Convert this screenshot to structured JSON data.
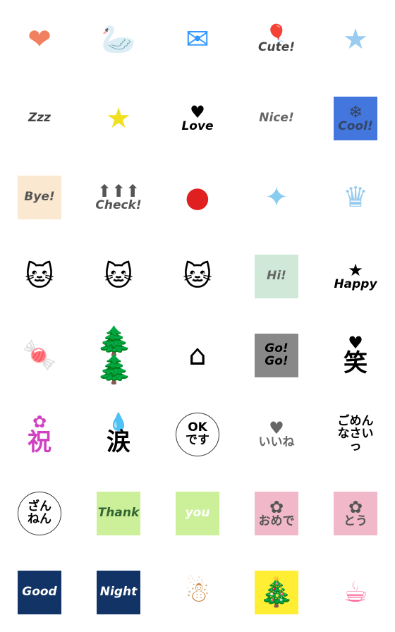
{
  "stickers": [
    {
      "icon": "hearts-icon",
      "text": "",
      "bg": "",
      "fg": "#f08060"
    },
    {
      "icon": "swan-icon",
      "text": "",
      "bg": "",
      "fg": "#b090d0"
    },
    {
      "icon": "envelope-icon",
      "text": "",
      "bg": "",
      "fg": "#3399ff"
    },
    {
      "icon": "balloons-icon",
      "text": "Cute!",
      "bg": "",
      "fg": "#444444"
    },
    {
      "icon": "stars-icon",
      "text": "",
      "bg": "",
      "fg": "#99ccee"
    },
    {
      "icon": "zzz-icon",
      "text": "Zzz",
      "bg": "",
      "fg": "#444444"
    },
    {
      "icon": "magic-wand-icon",
      "text": "",
      "bg": "",
      "fg": "#f0e020"
    },
    {
      "icon": "heart-icon",
      "text": "Love",
      "bg": "",
      "fg": "#000000"
    },
    {
      "icon": "bunting-icon",
      "text": "Nice!",
      "bg": "#ffffff",
      "fg": "#666666"
    },
    {
      "icon": "snowflake-icon",
      "text": "Cool!",
      "bg": "#4477dd",
      "fg": "#334466"
    },
    {
      "icon": "pastel-card-icon",
      "text": "Bye!",
      "bg": "#fbe8d0",
      "fg": "#555555"
    },
    {
      "icon": "arrows-up-icon",
      "text": "Check!",
      "bg": "",
      "fg": "#555555"
    },
    {
      "icon": "apple-icon",
      "text": "",
      "bg": "",
      "fg": "#e02020"
    },
    {
      "icon": "sparkle-icon",
      "text": "",
      "bg": "",
      "fg": "#88ccee"
    },
    {
      "icon": "crown-icon",
      "text": "",
      "bg": "",
      "fg": "#99ccee"
    },
    {
      "icon": "cat-sleepy-icon",
      "text": "",
      "bg": "",
      "fg": "#000000"
    },
    {
      "icon": "cat-face-icon",
      "text": "",
      "bg": "",
      "fg": "#000000"
    },
    {
      "icon": "cat-mask-icon",
      "text": "",
      "bg": "",
      "fg": "#000000"
    },
    {
      "icon": "checkered-card-icon",
      "text": "Hi!",
      "bg": "#cfe8d8",
      "fg": "#666666"
    },
    {
      "icon": "star-icon",
      "text": "Happy",
      "bg": "",
      "fg": "#000000"
    },
    {
      "icon": "candy-icon",
      "text": "",
      "bg": "",
      "fg": "#f0e020"
    },
    {
      "icon": "trees-icon",
      "text": "",
      "bg": "",
      "fg": "#339944"
    },
    {
      "icon": "house-icon",
      "text": "",
      "bg": "",
      "fg": "#000000"
    },
    {
      "icon": "dotted-card-icon",
      "text": "Go!\nGo!",
      "bg": "#888888",
      "fg": "#000000"
    },
    {
      "icon": "hearts-small-icon",
      "text": "笑",
      "bg": "",
      "fg": "#000000"
    },
    {
      "icon": "flowers-icon",
      "text": "祝",
      "bg": "",
      "fg": "#d040c0"
    },
    {
      "icon": "droplet-icon",
      "text": "涙",
      "bg": "",
      "fg": "#000000"
    },
    {
      "icon": "circle-badge-icon",
      "text": "OK\nです",
      "bg": "#ffffff",
      "fg": "#000000"
    },
    {
      "icon": "heart-balloon-icon",
      "text": "いいね",
      "bg": "",
      "fg": "#666666"
    },
    {
      "icon": "sweat-drops-icon",
      "text": "ごめん\nなさいっ",
      "bg": "",
      "fg": "#000000"
    },
    {
      "icon": "dotted-circle-icon",
      "text": "ざん\nねん",
      "bg": "#ffffff",
      "fg": "#000000"
    },
    {
      "icon": "leaf-card-icon",
      "text": "Thank",
      "bg": "#ccf099",
      "fg": "#336633"
    },
    {
      "icon": "leaf-card-icon",
      "text": "you",
      "bg": "#ccf099",
      "fg": "#ffffff"
    },
    {
      "icon": "flower-card-icon",
      "text": "おめで",
      "bg": "#f0b8c8",
      "fg": "#555555"
    },
    {
      "icon": "flower-card-icon",
      "text": "とう",
      "bg": "#f0b8c8",
      "fg": "#555555"
    },
    {
      "icon": "night-card-icon",
      "text": "Good",
      "bg": "#113366",
      "fg": "#ffffff"
    },
    {
      "icon": "night-card-icon",
      "text": "Night",
      "bg": "#113366",
      "fg": "#ffffff"
    },
    {
      "icon": "gingerbread-icon",
      "text": "",
      "bg": "#ffffff",
      "fg": "#cc8844"
    },
    {
      "icon": "christmas-tree-icon",
      "text": "",
      "bg": "#ffee33",
      "fg": "#339944"
    },
    {
      "icon": "mug-icon",
      "text": "",
      "bg": "",
      "fg": "#ff6699"
    }
  ]
}
